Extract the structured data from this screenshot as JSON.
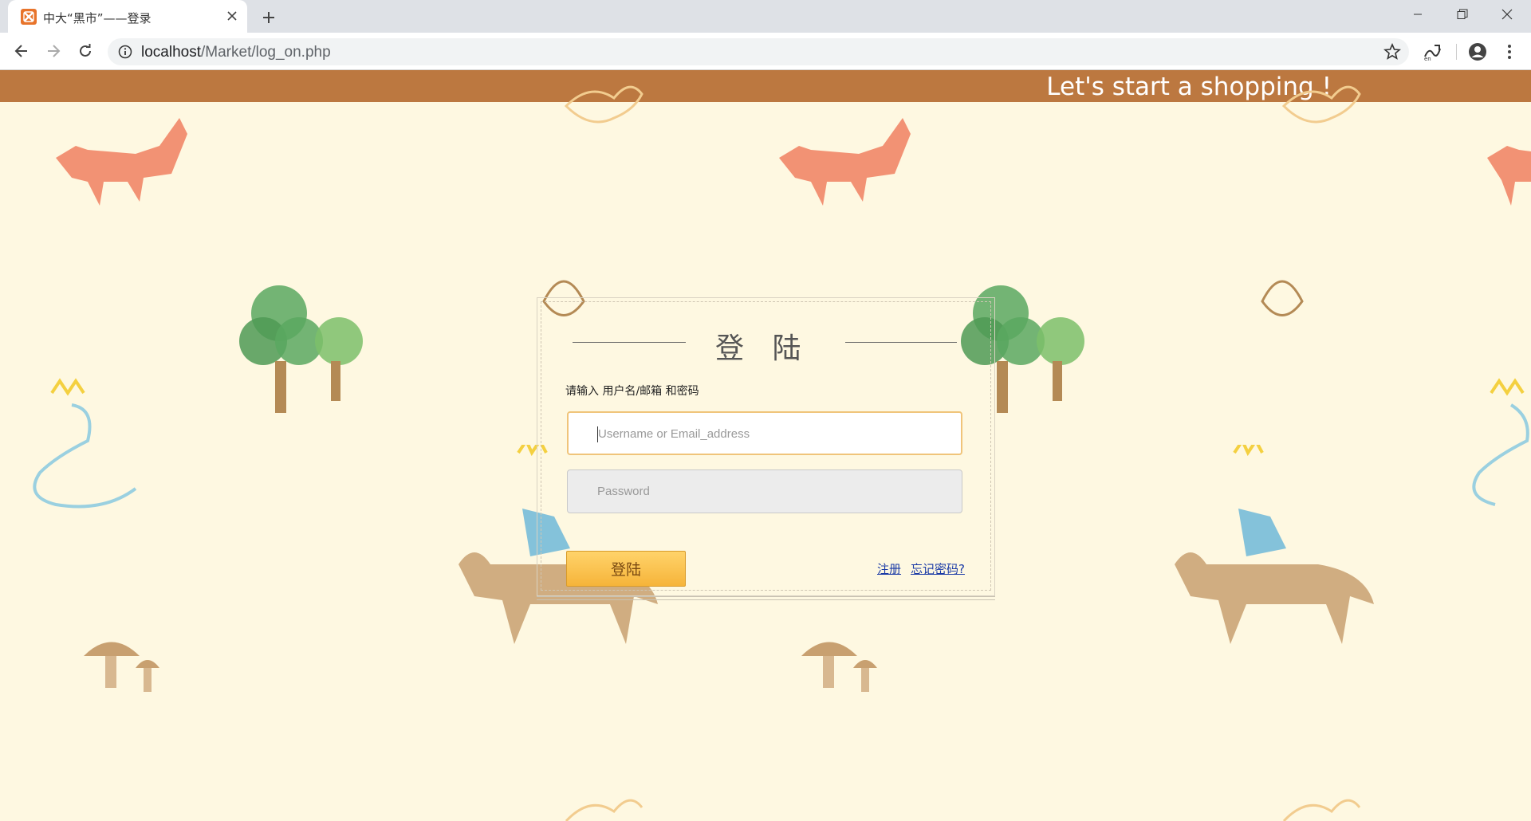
{
  "browser": {
    "tab_title": "中大“黑市”——登录",
    "url_host": "localhost",
    "url_path": "/Market/log_on.php"
  },
  "banner": {
    "text": "Let's start a shopping !"
  },
  "login": {
    "title": "登 陆",
    "hint": "请输入 用户名/邮箱 和密码",
    "username_placeholder": "Username or Email_address",
    "password_placeholder": "Password",
    "submit_label": "登陆",
    "register_link": "注册",
    "forgot_link": "忘记密码?"
  },
  "colors": {
    "banner": "#bc7840",
    "page_background": "#fef8e1",
    "button": "#f6b43a",
    "link": "#1a3aa6"
  }
}
